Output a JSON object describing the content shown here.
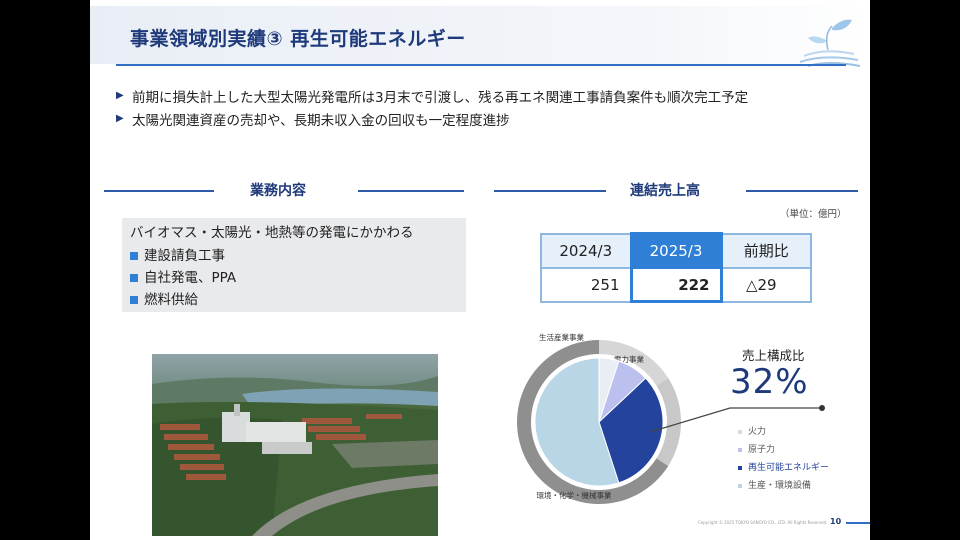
{
  "header": {
    "title": "事業領域別実績③  再生可能エネルギー"
  },
  "bullets": [
    "前期に損失計上した大型太陽光発電所は3月末で引渡し、残る再エネ関連工事請負案件も順次完工予定",
    "太陽光関連資産の売却や、長期未収入金の回収も一定程度進捗"
  ],
  "work": {
    "heading": "業務内容",
    "lead": "バイオマス・太陽光・地熱等の発電にかかわる",
    "items": [
      "建設請負工事",
      "自社発電、PPA",
      "燃料供給"
    ]
  },
  "sales": {
    "heading": "連結売上高",
    "unit": "（単位：億円）",
    "columns": [
      "2024/3",
      "2025/3",
      "前期比"
    ],
    "values": [
      "251",
      "222",
      "△29"
    ]
  },
  "composition": {
    "title": "売上構成比",
    "value": "32%",
    "segments": [
      {
        "name": "生活産業事業",
        "share": 0.16,
        "color": "#d6d6d6"
      },
      {
        "name": "電力事業",
        "share": 0.18,
        "color": "#c8c8c8"
      },
      {
        "name": "環境・化学・機械事業",
        "share": 0.66,
        "color": "#8f8f8f"
      }
    ],
    "inner_segments": [
      {
        "name": "火力",
        "share": 0.05,
        "color": "#e8eef3"
      },
      {
        "name": "原子力",
        "share": 0.08,
        "color": "#bcc0ee"
      },
      {
        "name": "再生可能エネルギー",
        "share": 0.32,
        "color": "#24439c"
      },
      {
        "name": "生産・環境設備",
        "share": 0.55,
        "color": "#b9d6e6"
      }
    ],
    "legend": [
      "火力",
      "原子力",
      "再生可能エネルギー",
      "生産・環境設備"
    ]
  },
  "footer": {
    "copyright": "Copyright © 2025 TOKYO SANGYO CO., LTD. All Rights Reserved.",
    "page": "10"
  }
}
